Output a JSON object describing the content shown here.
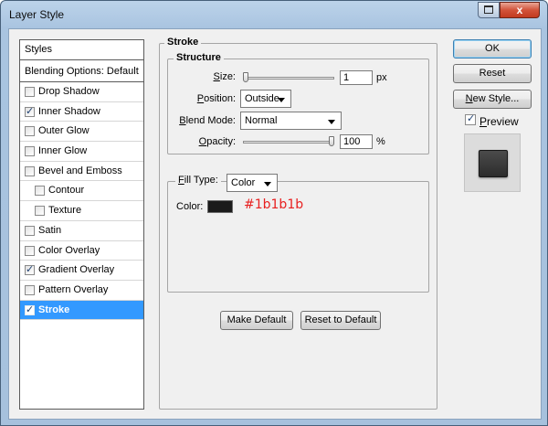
{
  "window": {
    "title": "Layer Style",
    "close_label": "x"
  },
  "styles_panel": {
    "header": "Styles",
    "blending_options": "Blending Options: Default",
    "items": [
      {
        "label": "Drop Shadow",
        "checked": false,
        "indent": false,
        "selected": false
      },
      {
        "label": "Inner Shadow",
        "checked": true,
        "indent": false,
        "selected": false
      },
      {
        "label": "Outer Glow",
        "checked": false,
        "indent": false,
        "selected": false
      },
      {
        "label": "Inner Glow",
        "checked": false,
        "indent": false,
        "selected": false
      },
      {
        "label": "Bevel and Emboss",
        "checked": false,
        "indent": false,
        "selected": false
      },
      {
        "label": "Contour",
        "checked": false,
        "indent": true,
        "selected": false
      },
      {
        "label": "Texture",
        "checked": false,
        "indent": true,
        "selected": false
      },
      {
        "label": "Satin",
        "checked": false,
        "indent": false,
        "selected": false
      },
      {
        "label": "Color Overlay",
        "checked": false,
        "indent": false,
        "selected": false
      },
      {
        "label": "Gradient Overlay",
        "checked": true,
        "indent": false,
        "selected": false
      },
      {
        "label": "Pattern Overlay",
        "checked": false,
        "indent": false,
        "selected": false
      },
      {
        "label": "Stroke",
        "checked": true,
        "indent": false,
        "selected": true
      }
    ]
  },
  "stroke": {
    "title": "Stroke",
    "structure": {
      "title": "Structure",
      "size_label": "Size:",
      "size_value": "1",
      "size_unit": "px",
      "position_label": "Position:",
      "position_value": "Outside",
      "blend_mode_label": "Blend Mode:",
      "blend_mode_value": "Normal",
      "opacity_label": "Opacity:",
      "opacity_value": "100",
      "opacity_unit": "%"
    },
    "fill": {
      "fill_type_label": "Fill Type:",
      "fill_type_value": "Color",
      "color_label": "Color:",
      "color_hex": "#1b1b1b",
      "annotation": "#1b1b1b"
    },
    "make_default_label": "Make Default",
    "reset_default_label": "Reset to Default"
  },
  "actions": {
    "ok_label": "OK",
    "reset_label": "Reset",
    "new_style_label": "New Style...",
    "preview_label": "Preview",
    "preview_checked": true
  },
  "colors": {
    "selected_row": "#3399ff",
    "annotation": "#e82020",
    "swatch": "#1b1b1b"
  }
}
